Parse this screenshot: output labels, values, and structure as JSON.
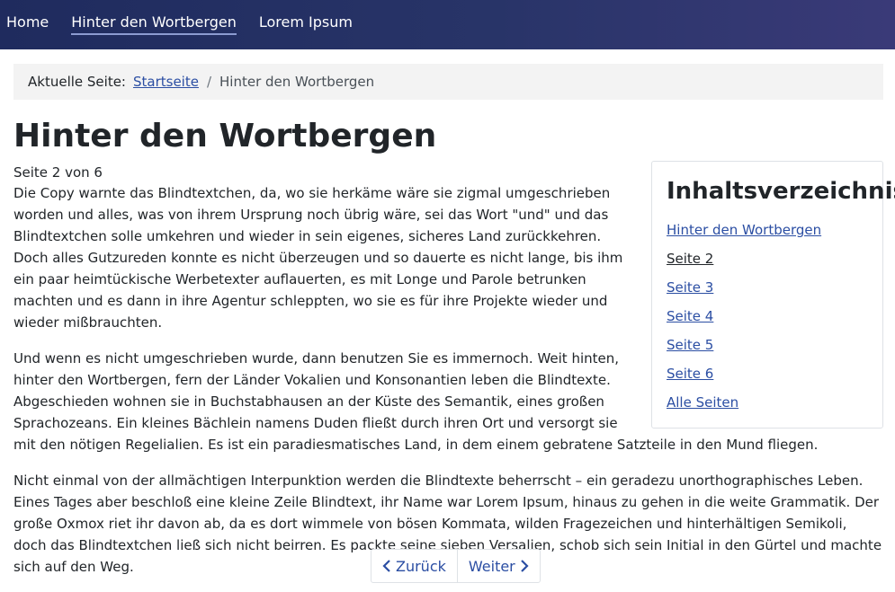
{
  "nav": {
    "items": [
      {
        "label": "Home"
      },
      {
        "label": "Hinter den Wortbergen"
      },
      {
        "label": "Lorem Ipsum"
      }
    ]
  },
  "breadcrumb": {
    "prefix": "Aktuelle Seite:",
    "home": "Startseite",
    "separator": "/",
    "current": "Hinter den Wortbergen"
  },
  "page": {
    "title": "Hinter den Wortbergen",
    "page_info": "Seite 2 von 6",
    "paragraphs": [
      "Die Copy warnte das Blindtextchen, da, wo sie herkäme wäre sie zigmal umgeschrieben worden und alles, was von ihrem Ursprung noch übrig wäre, sei das Wort \"und\" und das Blindtextchen solle umkehren und wieder in sein eigenes, sicheres Land zurückkehren. Doch alles Gutzureden konnte es nicht überzeugen und so dauerte es nicht lange, bis ihm ein paar heimtückische Werbetexter auflauerten, es mit Longe und Parole betrunken machten und es dann in ihre Agentur schleppten, wo sie es für ihre Projekte wieder und wieder mißbrauchten.",
      "Und wenn es nicht umgeschrieben wurde, dann benutzen Sie es immernoch. Weit hinten, hinter den Wortbergen, fern der Länder Vokalien und Konsonantien leben die Blindtexte. Abgeschieden wohnen sie in Buchstabhausen an der Küste des Semantik, eines großen Sprachozeans. Ein kleines Bächlein namens Duden fließt durch ihren Ort und versorgt sie mit den nötigen Regelialien. Es ist ein paradiesmatisches Land, in dem einem gebratene Satzteile in den Mund fliegen.",
      "Nicht einmal von der allmächtigen Interpunktion werden die Blindtexte beherrscht – ein geradezu unorthographisches Leben. Eines Tages aber beschloß eine kleine Zeile Blindtext, ihr Name war Lorem Ipsum, hinaus zu gehen in die weite Grammatik. Der große Oxmox riet ihr davon ab, da es dort wimmele von bösen Kommata, wilden Fragezeichen und hinterhältigen Semikoli, doch das Blindtextchen ließ sich nicht beirren. Es packte seine sieben Versalien, schob sich sein Initial in den Gürtel und machte sich auf den Weg."
    ]
  },
  "toc": {
    "title": "Inhaltsverzeichnis",
    "items": [
      {
        "label": "Hinter den Wortbergen"
      },
      {
        "label": "Seite 2"
      },
      {
        "label": "Seite 3"
      },
      {
        "label": "Seite 4"
      },
      {
        "label": "Seite 5"
      },
      {
        "label": "Seite 6"
      },
      {
        "label": "Alle Seiten"
      }
    ]
  },
  "pager": {
    "prev_label": "Zurück",
    "next_label": "Weiter"
  },
  "colors": {
    "nav_bg": "#283468",
    "link": "#2b4ea3",
    "breadcrumb_bg": "#f3f3f3"
  }
}
